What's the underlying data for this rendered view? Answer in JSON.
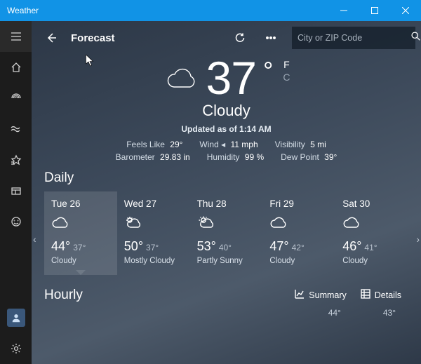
{
  "window": {
    "title": "Weather"
  },
  "header": {
    "title": "Forecast",
    "search_placeholder": "City or ZIP Code"
  },
  "sidebar": {
    "items": [
      "menu",
      "home",
      "radar",
      "maps",
      "favorites",
      "history",
      "feedback"
    ],
    "footer": [
      "profile",
      "settings"
    ]
  },
  "current": {
    "temp": "37",
    "condition": "Cloudy",
    "updated": "Updated as of 1:14 AM",
    "units": {
      "f_label": "F",
      "c_label": "C",
      "active": "F"
    },
    "stats_row1": [
      {
        "label": "Feels Like",
        "value": "29°"
      },
      {
        "label": "Wind",
        "value": "11 mph",
        "prefix_arrow": true
      },
      {
        "label": "Visibility",
        "value": "5 mi"
      }
    ],
    "stats_row2": [
      {
        "label": "Barometer",
        "value": "29.83 in"
      },
      {
        "label": "Humidity",
        "value": "99 %"
      },
      {
        "label": "Dew Point",
        "value": "39°"
      }
    ]
  },
  "daily": {
    "title": "Daily",
    "days": [
      {
        "name": "Tue 26",
        "hi": "44°",
        "lo": "37°",
        "cond": "Cloudy",
        "icon": "cloud",
        "selected": true
      },
      {
        "name": "Wed 27",
        "hi": "50°",
        "lo": "37°",
        "cond": "Mostly Cloudy",
        "icon": "mostly-cloudy",
        "selected": false
      },
      {
        "name": "Thu 28",
        "hi": "53°",
        "lo": "40°",
        "cond": "Partly Sunny",
        "icon": "partly-sunny",
        "selected": false
      },
      {
        "name": "Fri 29",
        "hi": "47°",
        "lo": "42°",
        "cond": "Cloudy",
        "icon": "cloud",
        "selected": false
      },
      {
        "name": "Sat 30",
        "hi": "46°",
        "lo": "41°",
        "cond": "Cloudy",
        "icon": "cloud",
        "selected": false
      }
    ]
  },
  "hourly": {
    "title": "Hourly",
    "summary_label": "Summary",
    "details_label": "Details",
    "visible_temps": [
      "44°",
      "43°"
    ]
  }
}
